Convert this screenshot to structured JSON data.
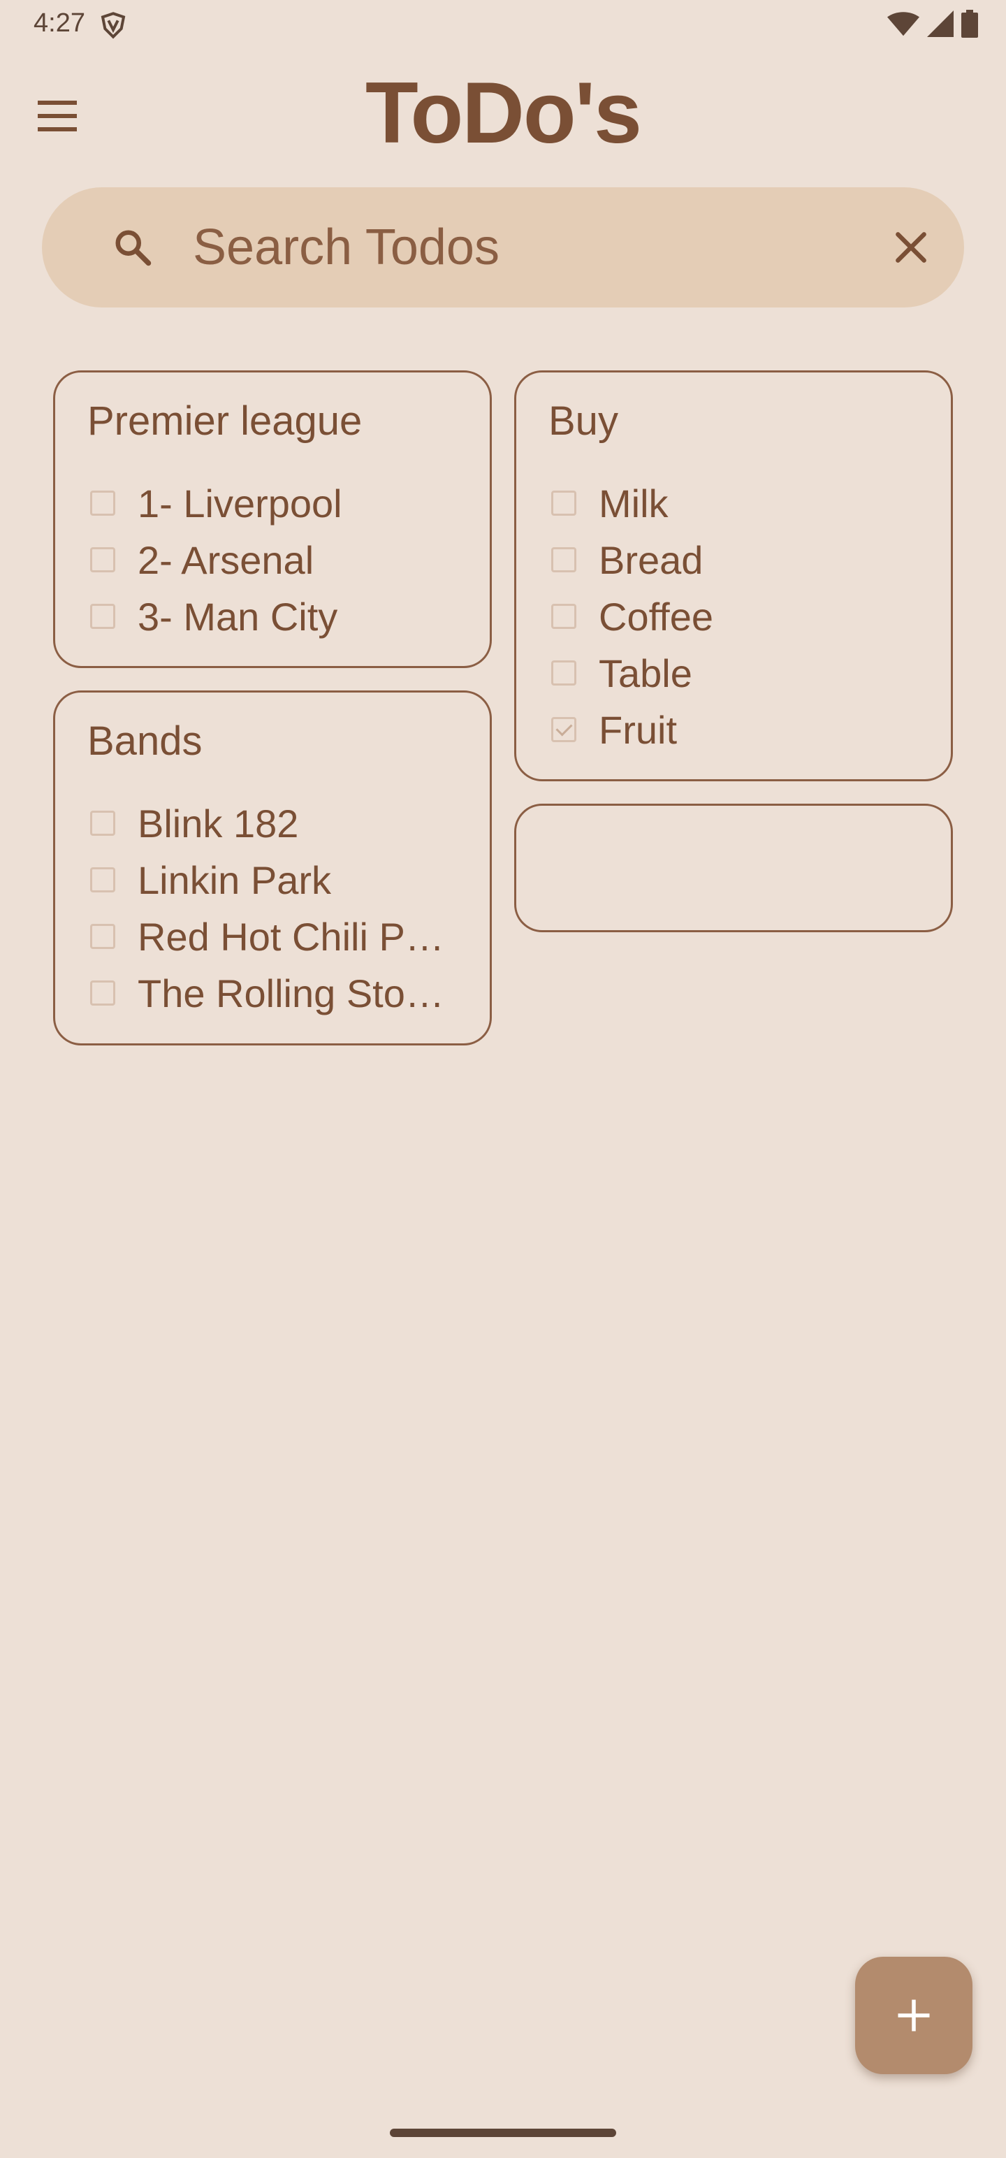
{
  "status_bar": {
    "time": "4:27",
    "icons": [
      "vpn-shield-icon",
      "wifi-icon",
      "signal-icon",
      "battery-icon"
    ]
  },
  "app": {
    "title": "ToDo's",
    "menu_icon": "hamburger-menu-icon"
  },
  "search": {
    "placeholder": "Search Todos",
    "value": "",
    "search_icon": "search-icon",
    "clear_icon": "close-icon"
  },
  "cards": [
    {
      "title": "Premier league",
      "items": [
        {
          "text": "1- Liverpool",
          "checked": false
        },
        {
          "text": "2- Arsenal",
          "checked": false
        },
        {
          "text": "3- Man City",
          "checked": false
        }
      ]
    },
    {
      "title": "Buy",
      "items": [
        {
          "text": "Milk",
          "checked": false
        },
        {
          "text": "Bread",
          "checked": false
        },
        {
          "text": "Coffee",
          "checked": false
        },
        {
          "text": "Table",
          "checked": false
        },
        {
          "text": "Fruit",
          "checked": true
        }
      ]
    },
    {
      "title": "Bands",
      "items": [
        {
          "text": "Blink 182",
          "checked": false
        },
        {
          "text": "Linkin Park",
          "checked": false
        },
        {
          "text": "Red Hot Chili Peppers",
          "checked": false
        },
        {
          "text": "The Rolling Stones",
          "checked": false
        }
      ]
    },
    {
      "title": "",
      "items": []
    }
  ],
  "fab": {
    "icon": "plus-icon"
  },
  "colors": {
    "background": "#ede0d6",
    "accent": "#7a4f35",
    "search_bg": "#e4cdb6",
    "fab_bg": "#b38b6d"
  }
}
